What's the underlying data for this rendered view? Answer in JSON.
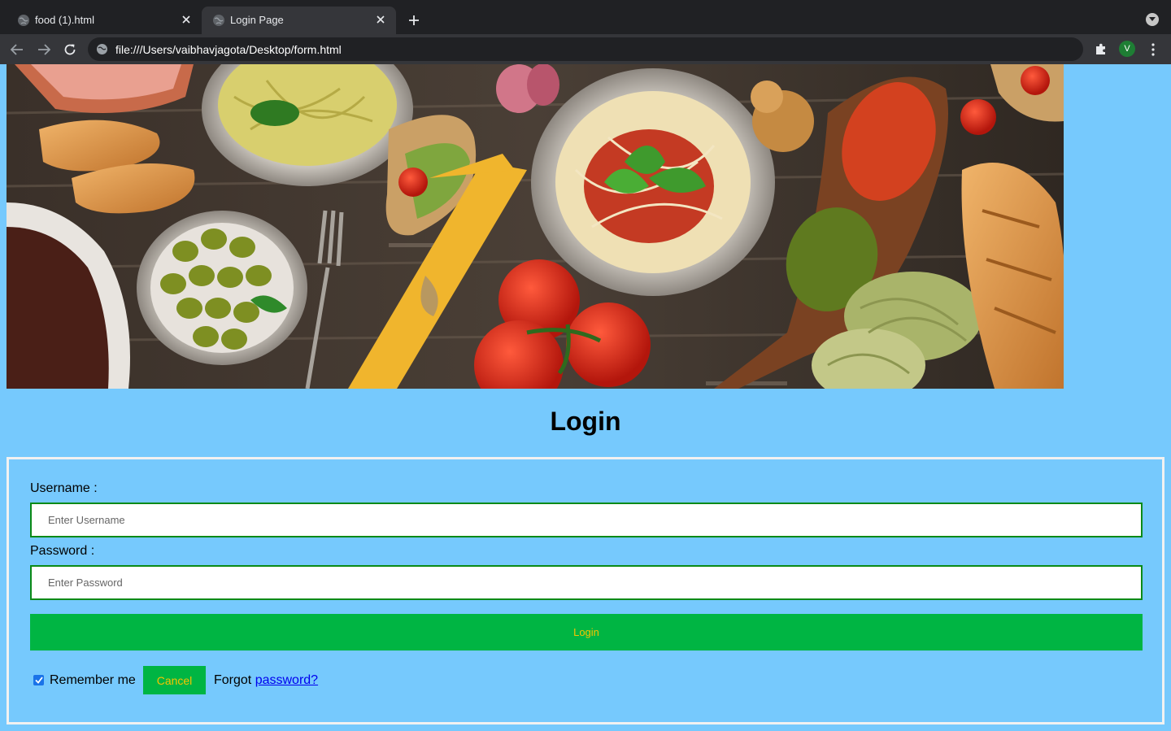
{
  "browser": {
    "tabs": [
      {
        "label": "food (1).html",
        "active": false
      },
      {
        "label": "Login Page",
        "active": true
      }
    ],
    "url": "file:///Users/vaibhavjagota/Desktop/form.html",
    "profile_initial": "V"
  },
  "page": {
    "title": "Login",
    "username_label": "Username :",
    "username_placeholder": "Enter Username",
    "password_label": "Password :",
    "password_placeholder": "Enter Password",
    "login_button": "Login",
    "remember_label": "Remember me",
    "remember_checked": true,
    "cancel_button": "Cancel",
    "forgot_text": "Forgot",
    "forgot_link": "password?"
  },
  "colors": {
    "page_background": "#76c9fd",
    "button_green": "#00b543",
    "button_text": "#f6c400",
    "input_border": "#0b8a17"
  }
}
